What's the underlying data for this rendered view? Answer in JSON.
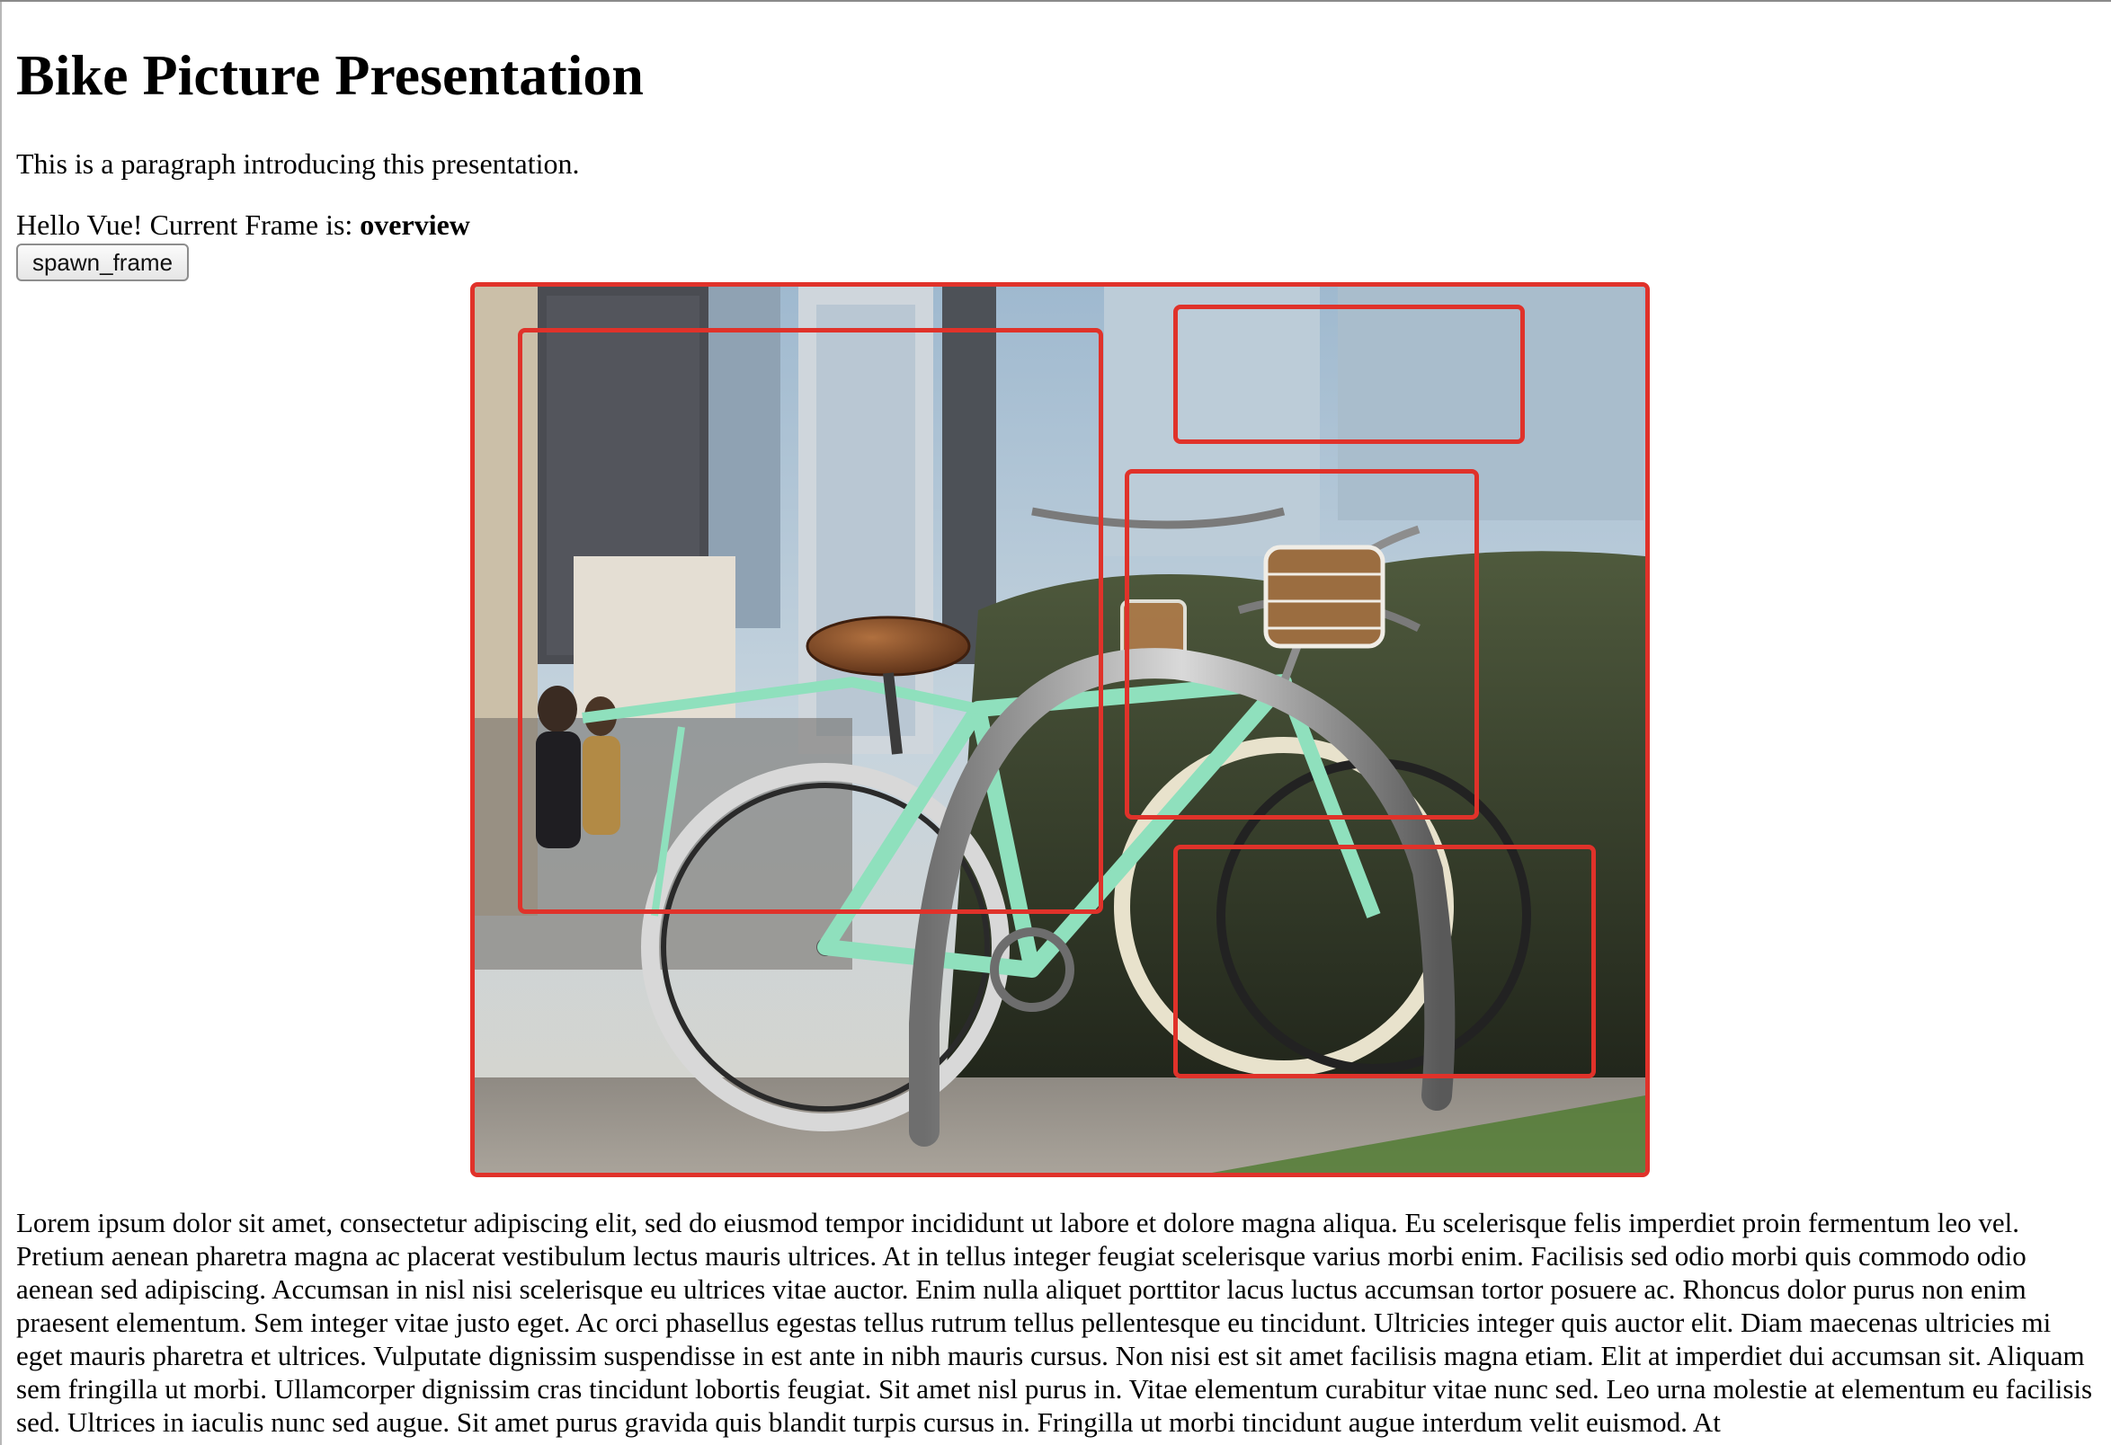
{
  "page": {
    "title": "Bike Picture Presentation",
    "intro": "This is a paragraph introducing this presentation.",
    "frame_prefix": "Hello Vue! Current Frame is: ",
    "current_frame": "overview",
    "spawn_button_label": "spawn_frame"
  },
  "accent_color": "#e0322a",
  "figure": {
    "subject": "mint green bicycle with wicker basket leaning on a steel bike rack",
    "highlight_regions": [
      "rear-wheel-and-saddle",
      "handlebars",
      "front-basket",
      "front-wheel"
    ]
  },
  "body_text": "Lorem ipsum dolor sit amet, consectetur adipiscing elit, sed do eiusmod tempor incididunt ut labore et dolore magna aliqua. Eu scelerisque felis imperdiet proin fermentum leo vel. Pretium aenean pharetra magna ac placerat vestibulum lectus mauris ultrices. At in tellus integer feugiat scelerisque varius morbi enim. Facilisis sed odio morbi quis commodo odio aenean sed adipiscing. Accumsan in nisl nisi scelerisque eu ultrices vitae auctor. Enim nulla aliquet porttitor lacus luctus accumsan tortor posuere ac. Rhoncus dolor purus non enim praesent elementum. Sem integer vitae justo eget. Ac orci phasellus egestas tellus rutrum tellus pellentesque eu tincidunt. Ultricies integer quis auctor elit. Diam maecenas ultricies mi eget mauris pharetra et ultrices. Vulputate dignissim suspendisse in est ante in nibh mauris cursus. Non nisi est sit amet facilisis magna etiam. Elit at imperdiet dui accumsan sit. Aliquam sem fringilla ut morbi. Ullamcorper dignissim cras tincidunt lobortis feugiat. Sit amet nisl purus in. Vitae elementum curabitur vitae nunc sed. Leo urna molestie at elementum eu facilisis sed. Ultrices in iaculis nunc sed augue. Sit amet purus gravida quis blandit turpis cursus in. Fringilla ut morbi tincidunt augue interdum velit euismod. At"
}
